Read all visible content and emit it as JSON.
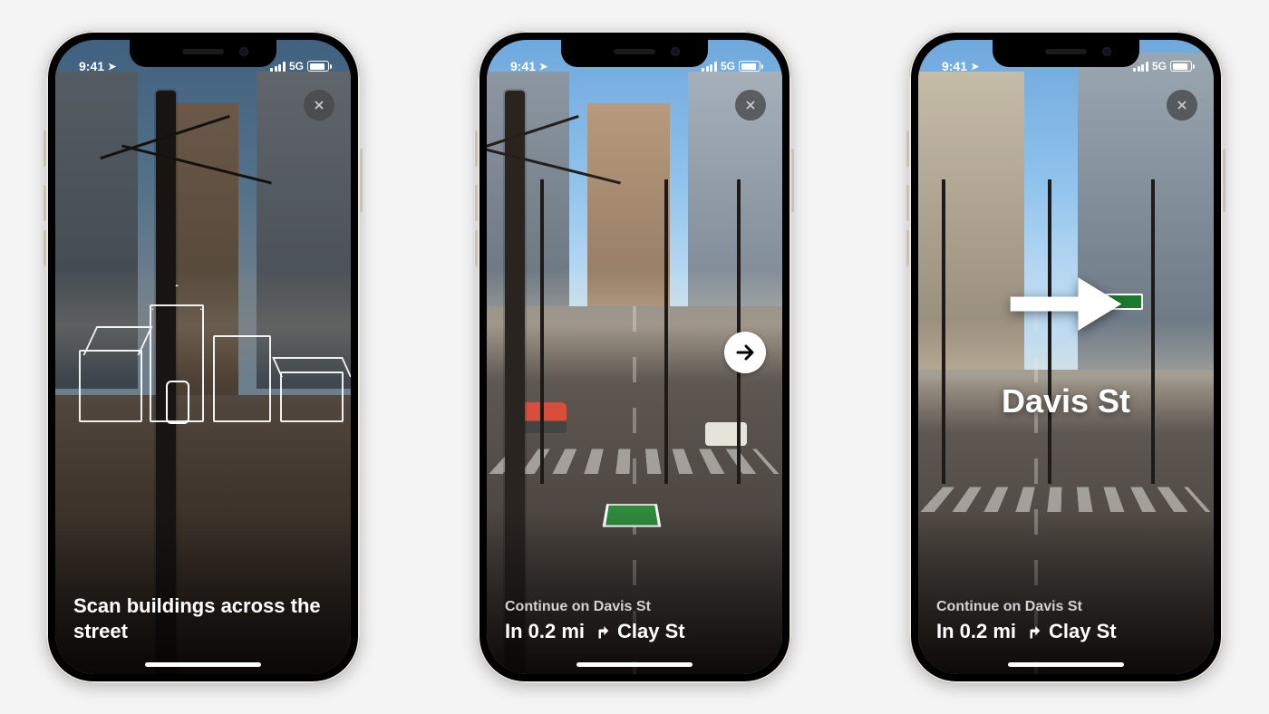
{
  "status_bar": {
    "time": "9:41",
    "network_type": "5G"
  },
  "screens": {
    "scan": {
      "instruction": "Scan buildings across the street"
    },
    "nav_small": {
      "continue_line": "Continue on Davis St",
      "distance": "In 0.2 mi",
      "turn_street": "Clay St"
    },
    "nav_ar": {
      "ar_street_label": "Davis St",
      "continue_line": "Continue on Davis St",
      "distance": "In 0.2 mi",
      "turn_street": "Clay St"
    }
  }
}
